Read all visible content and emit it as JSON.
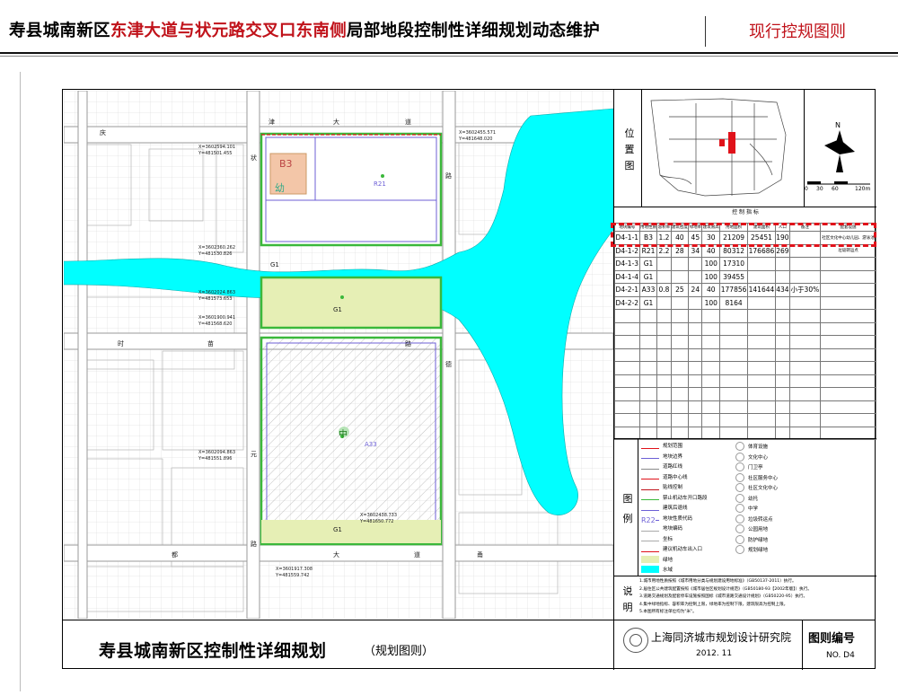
{
  "header": {
    "title_prefix": "寿县城南新区",
    "title_highlight": "东津大道与状元路交叉口东南侧",
    "title_suffix": "局部地段控制性详细规划动态维护",
    "right_label": "现行控规图则",
    "highlight_color": "#c0121a"
  },
  "plan": {
    "title": "寿县城南新区控制性详细规划",
    "subtitle": "（规划图则）",
    "institute": "上海同济城市规划设计研究院",
    "date": "2012. 11",
    "number_label": "图则编号",
    "number_value": "NO. D4"
  },
  "position_map": {
    "label": "位置图",
    "scale_labels": [
      "0",
      "30",
      "60",
      "120m"
    ]
  },
  "control_table": {
    "title": "控 制 指 标",
    "headers": [
      "地块编号",
      "用地性质",
      "容积率",
      "建筑密度",
      "绿地率",
      "建筑限高",
      "用地面积",
      "建筑面积",
      "人口",
      "备注",
      "配套设施"
    ],
    "rows": [
      [
        "D4-1-1",
        "B3",
        "1.2",
        "40",
        "45",
        "30",
        "21209",
        "25451",
        "190",
        "",
        "社区文化中心幼儿园、游泳池"
      ],
      [
        "D4-1-2",
        "R21",
        "2.2",
        "28",
        "34",
        "40",
        "80312",
        "176686",
        "269",
        "",
        "垃圾转运点"
      ],
      [
        "D4-1-3",
        "G1",
        "",
        "",
        "",
        "100",
        "17310",
        "",
        "",
        "",
        ""
      ],
      [
        "D4-1-4",
        "G1",
        "",
        "",
        "",
        "100",
        "39455",
        "",
        "",
        "",
        ""
      ],
      [
        "D4-2-1",
        "A33",
        "0.8",
        "25",
        "24",
        "40",
        "177856",
        "141644",
        "434",
        "小于30%",
        ""
      ],
      [
        "D4-2-2",
        "G1",
        "",
        "",
        "",
        "100",
        "8164",
        "",
        "",
        "",
        ""
      ]
    ]
  },
  "legend": {
    "label": "图例",
    "left_items": [
      "规划范围",
      "地块边界",
      "道路红线",
      "道路中心线",
      "贴线控制",
      "禁止机动车开口路段",
      "建筑后退线",
      "地块性质代码",
      "地块编码",
      "坐标",
      "建议机动车出入口",
      "绿地",
      "水域"
    ],
    "right_items": [
      "体育设施",
      "文化中心",
      "门卫亭",
      "社区服务中心",
      "社区文化中心",
      "幼托",
      "中学",
      "垃圾转运点",
      "公园用地",
      "防护绿地",
      "规划绿地"
    ],
    "code_sample": "R22"
  },
  "notes": {
    "label": "说明",
    "lines": [
      "1.城市用地性质按照《城市用地分类与规划建设用地标准》（GB50137-2011）执行。",
      "2.居住区公共建筑配置按照《城市居住区规划设计规范》（GB50180-93【2002年版】）执行。",
      "3.道路交通规划及配套停车设施按照国标《城市道路交通设计规划》（GB50220-95）执行。",
      "4.集中绿地指标、容积率为控制上限，绿地率为控制下限，建筑限高为控制上限。",
      "5.本图所有标注单位均为\"米\"。"
    ]
  },
  "map": {
    "road_chars": [
      "津",
      "大",
      "道",
      "状",
      "元",
      "路",
      "时",
      "苗",
      "路",
      "路",
      "德",
      "都",
      "大",
      "道",
      "甬",
      "庆"
    ],
    "parcel_codes": [
      "B3",
      "幼",
      "R21",
      "G1",
      "G1",
      "A33",
      "中",
      "G1"
    ],
    "coords": [
      "X=3602594.101",
      "Y=481501.455",
      "X=3602455.571",
      "Y=481648.020",
      "X=3602360.262",
      "Y=481530.826",
      "X=3602094.863",
      "Y=481551.896",
      "X=3601900.941",
      "Y=481568.620",
      "X=3602024.863",
      "Y=481573.653",
      "X=3602438.733",
      "Y=481650.772",
      "X=3601917.308",
      "Y=481559.742"
    ]
  },
  "colors": {
    "water": "#00ffff",
    "green": "#e6efb5",
    "blue_road": "#6c5fd6",
    "green_border": "#3bb83b",
    "red_accent": "#e0121a"
  }
}
